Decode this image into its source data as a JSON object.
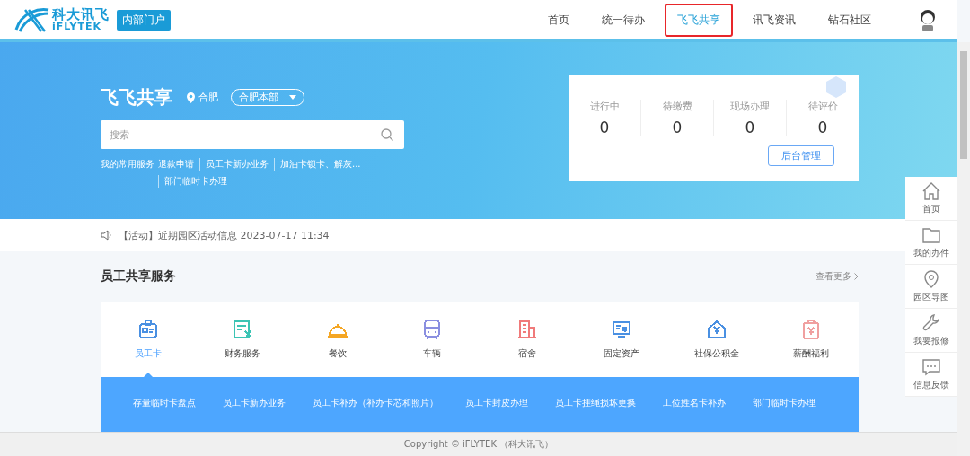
{
  "header": {
    "logo_text": "科大讯飞",
    "logo_sub": "iFLYTEK",
    "portal_badge": "内部门户",
    "nav": [
      {
        "label": "首页",
        "selected": false
      },
      {
        "label": "统一待办",
        "selected": false
      },
      {
        "label": "飞飞共享",
        "selected": true
      },
      {
        "label": "讯飞资讯",
        "selected": false
      },
      {
        "label": "钻石社区",
        "selected": false
      }
    ]
  },
  "banner": {
    "title": "飞飞共享",
    "city": "合肥",
    "campus_select": "合肥本部",
    "search": {
      "placeholder": "搜索"
    },
    "quick_links_label": "我的常用服务",
    "quick_links": [
      "退款申请",
      "员工卡新办业务",
      "加油卡锁卡、解灰...",
      "部门临时卡办理"
    ],
    "stats": [
      {
        "label": "进行中",
        "value": "0"
      },
      {
        "label": "待缴费",
        "value": "0"
      },
      {
        "label": "现场办理",
        "value": "0"
      },
      {
        "label": "待评价",
        "value": "0"
      }
    ],
    "admin_button": "后台管理"
  },
  "notice": "【活动】近期园区活动信息 2023-07-17 11:34",
  "services": {
    "title": "员工共享服务",
    "more_link": "查看更多",
    "categories": [
      {
        "label": "员工卡",
        "kind": "badge",
        "color": "#4a90e2",
        "selected": true
      },
      {
        "label": "财务服务",
        "kind": "bill",
        "color": "#3cc4b4",
        "selected": false
      },
      {
        "label": "餐饮",
        "kind": "cloche",
        "color": "#f5a623",
        "selected": false
      },
      {
        "label": "车辆",
        "kind": "bus",
        "color": "#8a8fe0",
        "selected": false
      },
      {
        "label": "宿舍",
        "kind": "building",
        "color": "#f07a7a",
        "selected": false
      },
      {
        "label": "固定资产",
        "kind": "screen",
        "color": "#4a90e2",
        "selected": false
      },
      {
        "label": "社保公积金",
        "kind": "house",
        "color": "#4a90e2",
        "selected": false
      },
      {
        "label": "薪酬福利",
        "kind": "wallet",
        "color": "#f0a0a0",
        "selected": false
      }
    ],
    "sub_links": [
      "存量临时卡盘点",
      "员工卡新办业务",
      "员工卡补办（补办卡芯和照片）",
      "员工卡封皮办理",
      "员工卡挂绳损坏更换",
      "工位姓名卡补办",
      "部门临时卡办理"
    ]
  },
  "sidebar": [
    {
      "label": "首页",
      "kind": "home"
    },
    {
      "label": "我的办件",
      "kind": "folder"
    },
    {
      "label": "园区导图",
      "kind": "pin"
    },
    {
      "label": "我要报修",
      "kind": "wrench"
    },
    {
      "label": "信息反馈",
      "kind": "chat"
    }
  ],
  "footer": {
    "copyright": "Copyright © iFLYTEK （科大讯飞）"
  }
}
